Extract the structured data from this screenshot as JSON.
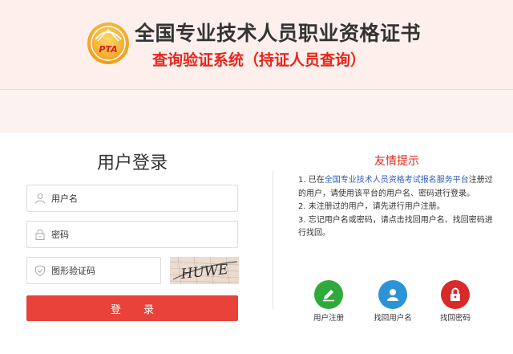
{
  "header": {
    "logo_text": "PTA",
    "title": "全国专业技术人员职业资格证书",
    "subtitle": "查询验证系统（持证人员查询）"
  },
  "login": {
    "title": "用户登录",
    "username_placeholder": "用户名",
    "password_placeholder": "密码",
    "captcha_placeholder": "图形验证码",
    "captcha_text": "HUWE",
    "submit_label": "登 录"
  },
  "tips": {
    "title": "友情提示",
    "item1_prefix": "1. 已在",
    "item1_link": "全国专业技术人员资格考试报名服务平台",
    "item1_suffix": "注册过的用户，请使用该平台的用户名、密码进行登录。",
    "item2": "2. 未注册过的用户，请先进行用户注册。",
    "item3": "3. 忘记用户名或密码，请点击找回用户名、找回密码进行找回。"
  },
  "actions": [
    {
      "label": "用户注册",
      "icon": "pencil-icon",
      "color": "#2faa3a"
    },
    {
      "label": "找回用户名",
      "icon": "user-icon",
      "color": "#2c93d6"
    },
    {
      "label": "找回密码",
      "icon": "lock-icon",
      "color": "#d92a2a"
    }
  ],
  "colors": {
    "accent_red": "#e8251b",
    "button_red": "#e8423a",
    "link_blue": "#2d5fc2",
    "logo_gold": "#f0a020"
  }
}
